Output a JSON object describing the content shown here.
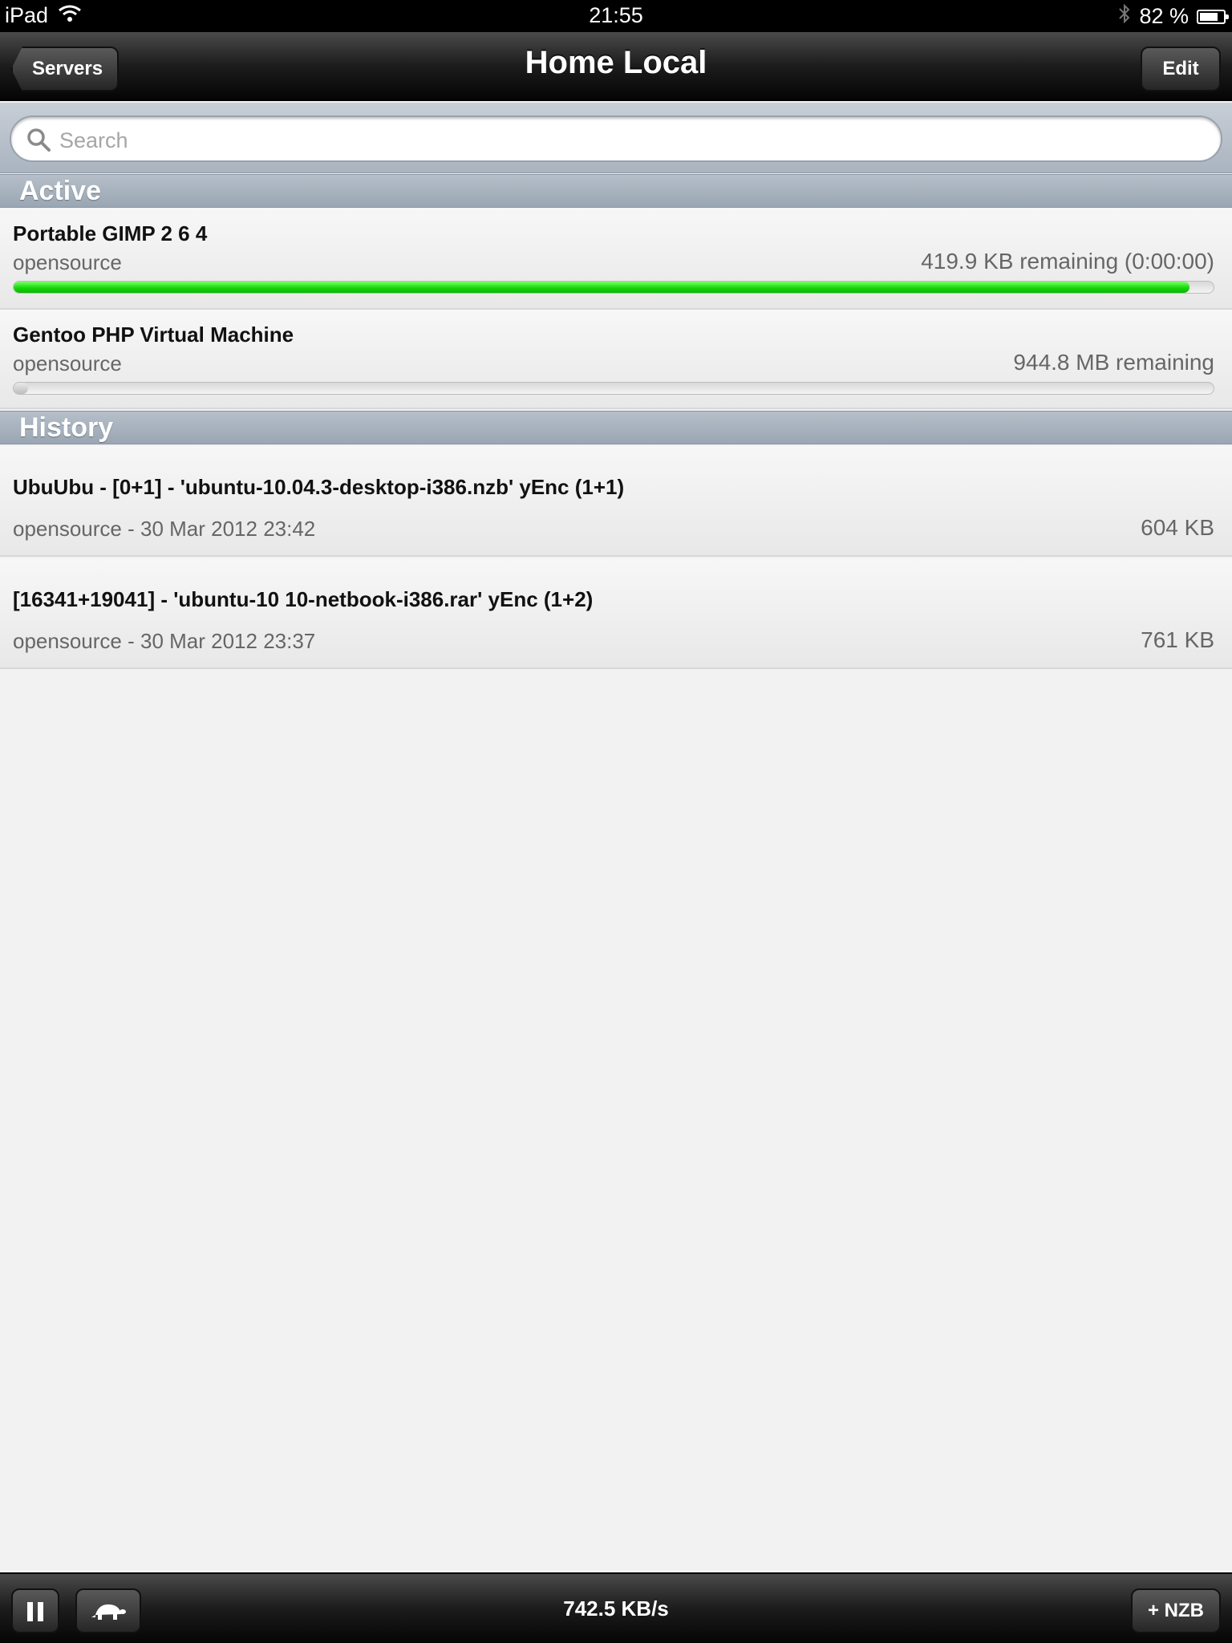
{
  "status_bar": {
    "device": "iPad",
    "time": "21:55",
    "battery_percent": "82 %",
    "battery_level": 0.82
  },
  "nav": {
    "back_label": "Servers",
    "title": "Home Local",
    "edit_label": "Edit"
  },
  "search": {
    "placeholder": "Search"
  },
  "sections": {
    "active_header": "Active",
    "history_header": "History"
  },
  "active": [
    {
      "title": "Portable GIMP 2 6 4",
      "category": "opensource",
      "remaining": "419.9 KB remaining (0:00:00)",
      "progress": 0.98
    },
    {
      "title": "Gentoo PHP Virtual Machine",
      "category": "opensource",
      "remaining": "944.8 MB remaining",
      "progress": 0.0
    }
  ],
  "history": [
    {
      "title": "UbuUbu - [0+1] - 'ubuntu-10.04.3-desktop-i386.nzb' yEnc (1+1)",
      "meta": "opensource - 30 Mar 2012 23:42",
      "size": "604 KB"
    },
    {
      "title": "[16341+19041] - 'ubuntu-10 10-netbook-i386.rar' yEnc (1+2)",
      "meta": "opensource - 30 Mar 2012 23:37",
      "size": "761 KB"
    }
  ],
  "toolbar": {
    "speed": "742.5 KB/s",
    "add_nzb_label": "+ NZB",
    "pause_icon": "pause-icon",
    "speed_limit_icon": "turtle-icon"
  },
  "colors": {
    "progress_green": "#15d90a",
    "section_header": "#a9b4c0"
  }
}
